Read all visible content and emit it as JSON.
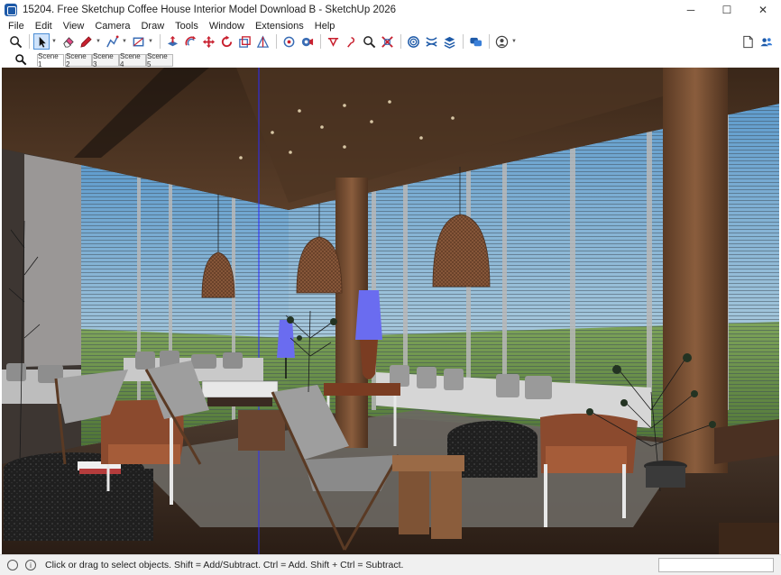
{
  "window": {
    "title": "15204. Free Sketchup Coffee House Interior Model Download B - SketchUp 2026",
    "minimize_glyph": "─",
    "maximize_glyph": "☐",
    "close_glyph": "✕"
  },
  "menu": {
    "items": [
      {
        "label": "File"
      },
      {
        "label": "Edit"
      },
      {
        "label": "View"
      },
      {
        "label": "Camera"
      },
      {
        "label": "Draw"
      },
      {
        "label": "Tools"
      },
      {
        "label": "Window"
      },
      {
        "label": "Extensions"
      },
      {
        "label": "Help"
      }
    ]
  },
  "toolbar": {
    "icons": [
      "search-icon",
      "select-arrow-icon",
      "eraser-icon",
      "pencil-icon",
      "line-tool-icon",
      "shape-tool-icon",
      "push-pull-icon",
      "offset-icon",
      "move-icon",
      "rotate-icon",
      "scale-icon",
      "follow-me-icon",
      "paint-bucket-icon",
      "tape-measure-icon",
      "dimension-icon",
      "protractor-icon",
      "text-icon",
      "axes-icon",
      "section-plane-icon",
      "sandbox-icon",
      "3d-warehouse-icon",
      "extension-warehouse-icon",
      "account-icon"
    ],
    "accent": "#c8202f",
    "selected_accent": "#4d8fd6"
  },
  "scenes": {
    "tabs": [
      {
        "label": "Scene 1",
        "active": true
      },
      {
        "label": "Scene 2",
        "active": false
      },
      {
        "label": "Scene 3",
        "active": false
      },
      {
        "label": "Scene 4",
        "active": false
      },
      {
        "label": "Scene 5",
        "active": false
      }
    ]
  },
  "status": {
    "info_glyph": "i",
    "hint": "Click or drag to select objects. Shift = Add/Subtract. Ctrl = Add. Shift + Ctrl = Subtract.",
    "measurements_label": ""
  },
  "colors": {
    "ceiling": "#4a3322",
    "floor": "#3a2a20",
    "sky": "#8bbad9",
    "grass": "#6a8f4a",
    "lamp_shade": "#8b5a3c",
    "lamp_blue": "#6a6cf0",
    "chair_leather": "#8b4a2e"
  }
}
